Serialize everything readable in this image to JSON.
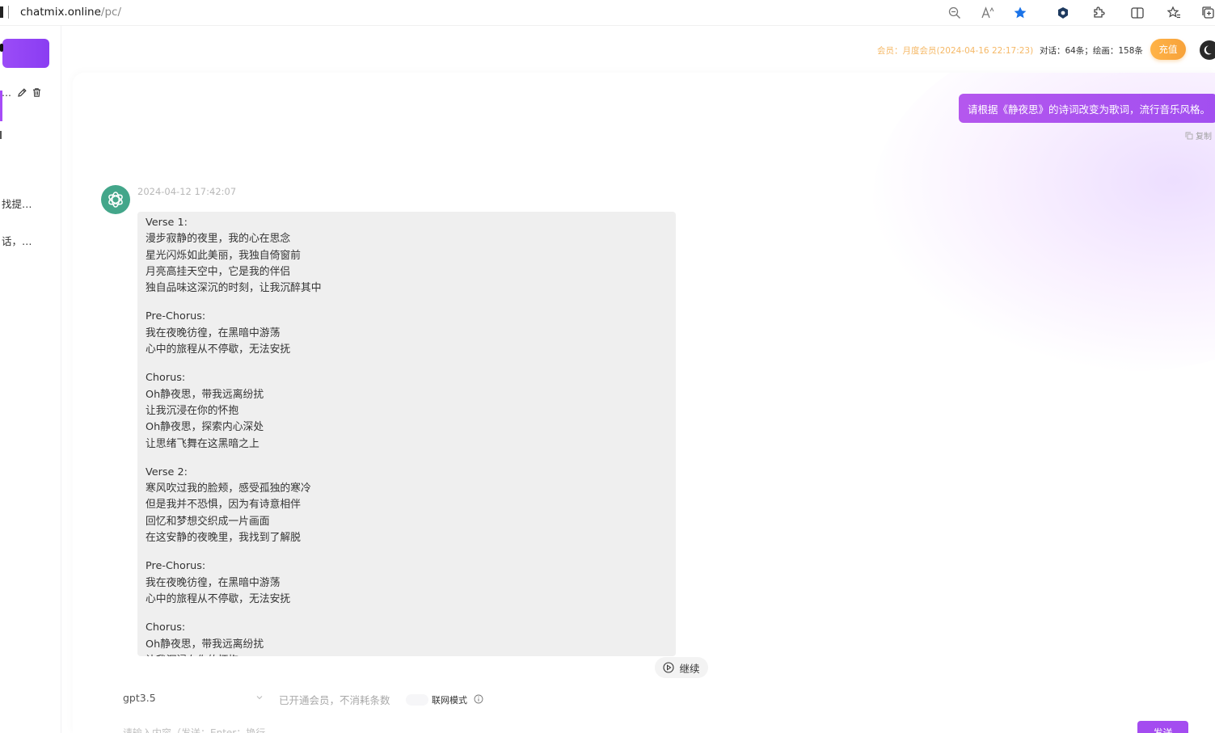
{
  "browser": {
    "url_host": "chatmix.online",
    "url_path": "/pc/"
  },
  "sidebar": {
    "row_dots": "…",
    "items": [
      {
        "label": "找提…"
      },
      {
        "label": "话，…"
      }
    ]
  },
  "header": {
    "member_text": "会员：月度会员(2024-04-16 22:17:23)",
    "usage_text": "对话：64条；绘画：158条",
    "recharge_label": "充值"
  },
  "chat": {
    "user_message": "请根据《静夜思》的诗词改变为歌词，流行音乐风格。",
    "copy_label": "复制",
    "bot_timestamp": "2024-04-12 17:42:07",
    "reply_stanzas": [
      [
        "Verse 1:",
        "漫步寂静的夜里，我的心在思念",
        "星光闪烁如此美丽，我独自倚窗前",
        "月亮高挂天空中，它是我的伴侣",
        "独自品味这深沉的时刻，让我沉醉其中"
      ],
      [
        "Pre-Chorus:",
        "我在夜晚彷徨，在黑暗中游荡",
        "心中的旅程从不停歇，无法安抚"
      ],
      [
        "Chorus:",
        "Oh静夜思，带我远离纷扰",
        "让我沉浸在你的怀抱",
        "Oh静夜思，探索内心深处",
        "让思绪飞舞在这黑暗之上"
      ],
      [
        "Verse 2:",
        "寒风吹过我的脸颊，感受孤独的寒冷",
        "但是我并不恐惧，因为有诗意相伴",
        "回忆和梦想交织成一片画面",
        "在这安静的夜晚里，我找到了解脱"
      ],
      [
        "Pre-Chorus:",
        "我在夜晚彷徨，在黑暗中游荡",
        "心中的旅程从不停歇，无法安抚"
      ],
      [
        "Chorus:",
        "Oh静夜思，带我远离纷扰",
        "让我沉浸在你的怀抱"
      ]
    ],
    "continue_label": "继续"
  },
  "input": {
    "model": "gpt3.5",
    "member_note": "已开通会员，不消耗条数",
    "web_mode_label": "联网模式",
    "placeholder": "请输入内容（发送：Enter；换行",
    "send_label": "发送"
  },
  "colors": {
    "accent_purple": "#a24ff0",
    "recharge_orange": "#f7a23a",
    "member_gold": "#f5b866",
    "bot_avatar_green": "#43a68a",
    "reply_bg": "#efefef"
  }
}
